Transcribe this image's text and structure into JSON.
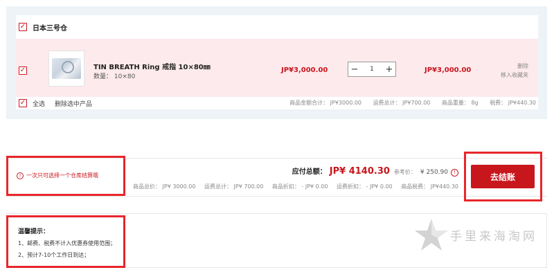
{
  "warehouse": {
    "name": "日本三号仓"
  },
  "item": {
    "title": "TIN BREATH Ring 戒指 10×80㎜",
    "qty_label": "数量： 10×80",
    "price": "JP¥3,000.00",
    "quantity": "1",
    "subtotal": "JP¥3,000.00",
    "delete": "删除",
    "move_to_favorites": "移入收藏夹"
  },
  "cart_footer": {
    "select_all": "全选",
    "delete_selected": "删除选中产品",
    "summary": {
      "goods_total": "商品金额合计： JP¥3000.00",
      "shipping": "运费总计： JP¥700.00",
      "weight": "商品重量： 8g",
      "tax": "税费： JP¥440.30"
    }
  },
  "checkout": {
    "warning": "一次只可选择一个仓库结算哦",
    "total_label": "应付总额：",
    "total_value": "JP¥ 4140.30",
    "ref_label": "参考价：",
    "ref_value": "¥ 250.90",
    "details": {
      "goods_total": "商品总价： JP¥ 3000.00",
      "shipping_total": "运费总计： JP¥ 700.00",
      "goods_discount": "商品折扣： - JP¥ 0.00",
      "shipping_discount": "运费折扣： - JP¥ 0.00",
      "goods_tax": "商品税费： JP¥440.30"
    },
    "button_label": "去结账"
  },
  "tips": {
    "title": "温馨提示：",
    "items": [
      "1、邮费、税费不计入优惠券使用范围；",
      "2、预计7-10个工作日到达；"
    ]
  },
  "watermark": {
    "text": "手里来海淘网"
  },
  "colors": {
    "accent": "#c8161d",
    "highlight_frame": "#e8262b",
    "row_bg": "#fdeaec",
    "panel_bg": "#edf3f7"
  }
}
